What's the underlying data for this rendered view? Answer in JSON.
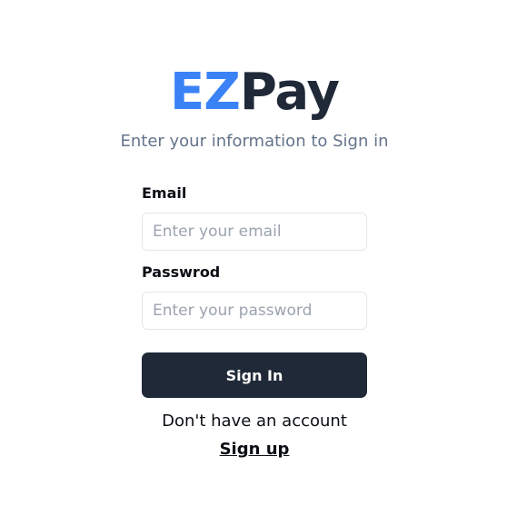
{
  "logo": {
    "part1": "EZ",
    "part2": "Pay",
    "colors": {
      "part1": "#3b82f6",
      "part2": "#1f2937"
    }
  },
  "subtitle": "Enter your information to Sign in",
  "form": {
    "email": {
      "label": "Email",
      "placeholder": "Enter your email",
      "value": ""
    },
    "password": {
      "label": "Passwrod",
      "placeholder": "Enter your password",
      "value": ""
    },
    "submit_label": "Sign In"
  },
  "footer": {
    "prompt": "Don't have an account",
    "signup_label": "Sign up"
  },
  "colors": {
    "button_bg": "#1f2937",
    "subtitle": "#64748b",
    "input_border": "#e5e7eb"
  }
}
